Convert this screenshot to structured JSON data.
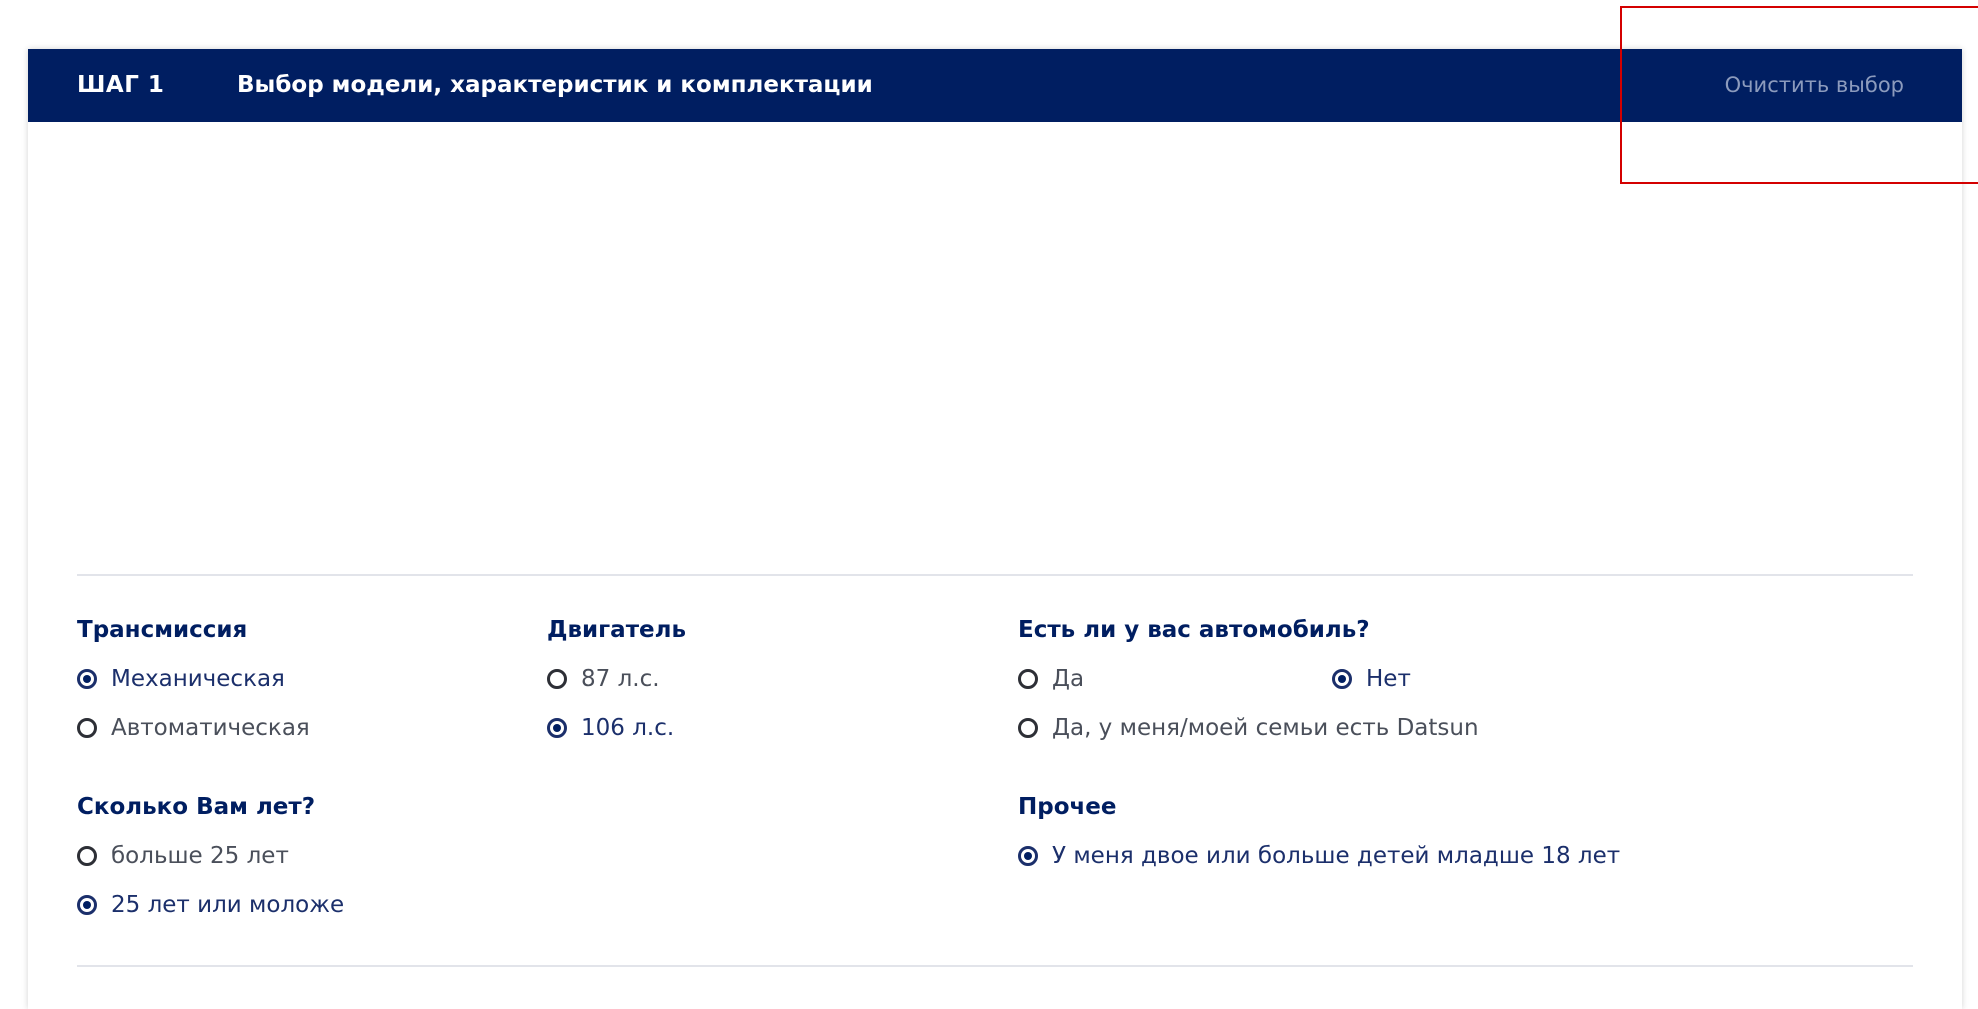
{
  "header": {
    "step_label": "ШАГ 1",
    "step_title": "Выбор модели, характеристик и комплектации",
    "clear_label": "Очистить выбор"
  },
  "groups": {
    "transmission": {
      "title": "Трансмиссия",
      "options": [
        {
          "label": "Механическая",
          "selected": true
        },
        {
          "label": "Автоматическая",
          "selected": false
        }
      ]
    },
    "engine": {
      "title": "Двигатель",
      "options": [
        {
          "label": "87 л.с.",
          "selected": false
        },
        {
          "label": "106 л.с.",
          "selected": true
        }
      ]
    },
    "has_car": {
      "title": "Есть ли у вас автомобиль?",
      "options": [
        {
          "label": "Да",
          "selected": false
        },
        {
          "label": "Нет",
          "selected": true
        },
        {
          "label": "Да, у меня/моей семьи есть Datsun",
          "selected": false
        }
      ]
    },
    "age": {
      "title": "Сколько Вам лет?",
      "options": [
        {
          "label": "больше 25 лет",
          "selected": false
        },
        {
          "label": "25 лет или моложе",
          "selected": true
        }
      ]
    },
    "other": {
      "title": "Прочее",
      "options": [
        {
          "label": "У меня двое или больше детей младше 18 лет",
          "selected": true
        }
      ]
    }
  },
  "colors": {
    "header_bg": "#001e61",
    "clear_link": "#8c9bbd",
    "highlight_border": "#d40000"
  }
}
